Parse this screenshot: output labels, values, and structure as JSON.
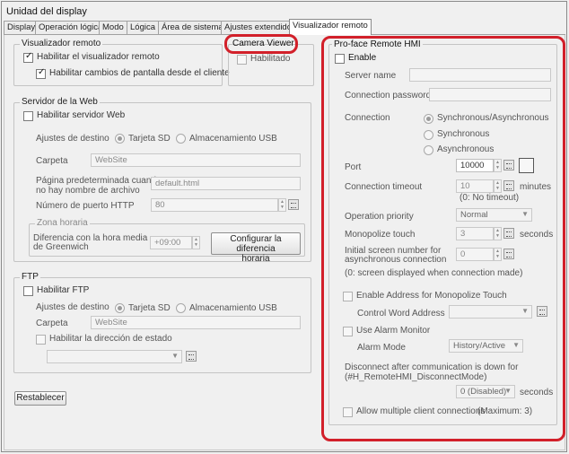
{
  "window": {
    "title": "Unidad del display"
  },
  "tabs": [
    "Display",
    "Operación lógica",
    "Modo",
    "Lógica",
    "Área de sistema",
    "Ajustes extendidos",
    "Visualizador remoto"
  ],
  "visualizador_remoto": {
    "group_title": "Visualizador remoto",
    "enable_label": "Habilitar el visualizador remoto",
    "allow_changes_label": "Habilitar cambios de pantalla desde el cliente"
  },
  "camera_viewer": {
    "group_title": "Camera Viewer",
    "enable_label": "Habilitado"
  },
  "web_server": {
    "group_title": "Servidor de la Web",
    "enable_label": "Habilitar servidor Web",
    "dest_label": "Ajustes de destino",
    "opt_sd": "Tarjeta SD",
    "opt_usb": "Almacenamiento USB",
    "folder_label": "Carpeta",
    "folder_value": "WebSite",
    "default_page_label_1": "Página predeterminada cuando",
    "default_page_label_2": "no hay nombre de archivo",
    "default_page_value": "default.html",
    "port_label": "Número de puerto HTTP",
    "port_value": "80",
    "tz_title": "Zona horaria",
    "tz_label_1": "Diferencia con la hora media",
    "tz_label_2": "de Greenwich",
    "tz_value": "+09:00",
    "tz_button_1": "Configurar la diferencia",
    "tz_button_2": "horaria"
  },
  "ftp": {
    "group_title": "FTP",
    "enable_label": "Habilitar FTP",
    "dest_label": "Ajustes de destino",
    "opt_sd": "Tarjeta SD",
    "opt_usb": "Almacenamiento USB",
    "folder_label": "Carpeta",
    "folder_value": "WebSite",
    "status_label": "Habilitar la dirección de estado"
  },
  "reset_button": "Restablecer",
  "hmi": {
    "group_title": "Pro-face Remote HMI",
    "enable_label": "Enable",
    "server_name_label": "Server name",
    "password_label": "Connection password",
    "connection_label": "Connection",
    "conn_opt_1": "Synchronous/Asynchronous",
    "conn_opt_2": "Synchronous",
    "conn_opt_3": "Asynchronous",
    "port_label": "Port",
    "port_value": "10000",
    "timeout_label": "Connection timeout",
    "timeout_value": "10",
    "timeout_unit": "minutes",
    "timeout_note": "(0: No timeout)",
    "priority_label": "Operation priority",
    "priority_value": "Normal",
    "monopolize_label": "Monopolize touch",
    "monopolize_value": "3",
    "monopolize_unit": "seconds",
    "initial_screen_label_1": "Initial screen number for",
    "initial_screen_label_2": "asynchronous connection",
    "initial_screen_value": "0",
    "initial_screen_note": "(0: screen displayed when connection made)",
    "enable_address_label": "Enable Address for Monopolize Touch",
    "control_word_label": "Control Word Address",
    "alarm_monitor_label": "Use Alarm Monitor",
    "alarm_mode_label": "Alarm Mode",
    "alarm_mode_value": "History/Active",
    "disconnect_label_1": "Disconnect after communication is down for",
    "disconnect_label_2": "(#H_RemoteHMI_DisconnectMode)",
    "disconnect_value": "0 (Disabled)",
    "disconnect_unit": "seconds",
    "multi_clients_label": "Allow multiple client connections",
    "multi_clients_note": "(Maximum: 3)"
  },
  "colors": {
    "highlight": "#d2202a"
  }
}
